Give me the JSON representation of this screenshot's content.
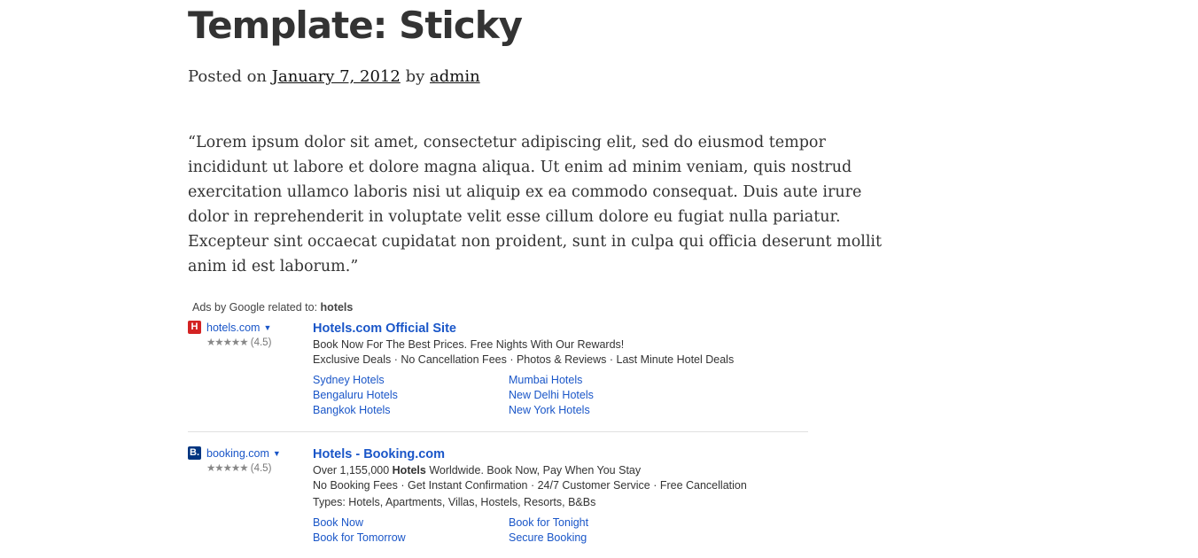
{
  "post": {
    "title": "Template: Sticky",
    "posted_on": "Posted on",
    "date": "January 7, 2012",
    "by": "by",
    "author": "admin",
    "quote": "“Lorem ipsum dolor sit amet, consectetur adipiscing elit, sed do eiusmod tempor incididunt ut labore et dolore magna aliqua. Ut enim ad minim veniam, quis nostrud exercitation ullamco laboris nisi ut aliquip ex ea commodo consequat. Duis aute irure dolor in reprehenderit in voluptate velit esse cillum dolore eu fugiat nulla pariatur. Excepteur sint occaecat cupidatat non proident, sunt in culpa qui officia deserunt mollit anim id est laborum.”"
  },
  "ads": {
    "header_prefix": "Ads by Google related to:",
    "header_keyword": "hotels",
    "items": [
      {
        "domain": "hotels.com",
        "icon": "hotels-logo-icon",
        "icon_glyph": "H",
        "stars": "★★★★★",
        "rating": "(4.5)",
        "title": "Hotels.com Official Site",
        "line1": "Book Now For The Best Prices. Free Nights With Our Rewards!",
        "line2": "Exclusive Deals · No Cancellation Fees · Photos & Reviews · Last Minute Hotel Deals",
        "sitelinks": [
          "Sydney Hotels",
          "Mumbai Hotels",
          "Bengaluru Hotels",
          "New Delhi Hotels",
          "Bangkok Hotels",
          "New York Hotels"
        ]
      },
      {
        "domain": "booking.com",
        "icon": "booking-logo-icon",
        "icon_glyph": "B.",
        "stars": "★★★★★",
        "rating": "(4.5)",
        "title": "Hotels - Booking.com",
        "line1_pre": "Over 1,155,000 ",
        "line1_bold": "Hotels",
        "line1_post": " Worldwide. Book Now, Pay When You Stay",
        "line2": "No Booking Fees · Get Instant Confirmation · 24/7 Customer Service · Free Cancellation",
        "line3": "Types: Hotels, Apartments, Villas, Hostels, Resorts, B&Bs",
        "sitelinks": [
          "Book Now",
          "Book for Tonight",
          "Book for Tomorrow",
          "Secure Booking"
        ]
      }
    ]
  },
  "colors": {
    "link": "#1a56c8",
    "text": "#333333",
    "divider": "#e0e0e0"
  }
}
